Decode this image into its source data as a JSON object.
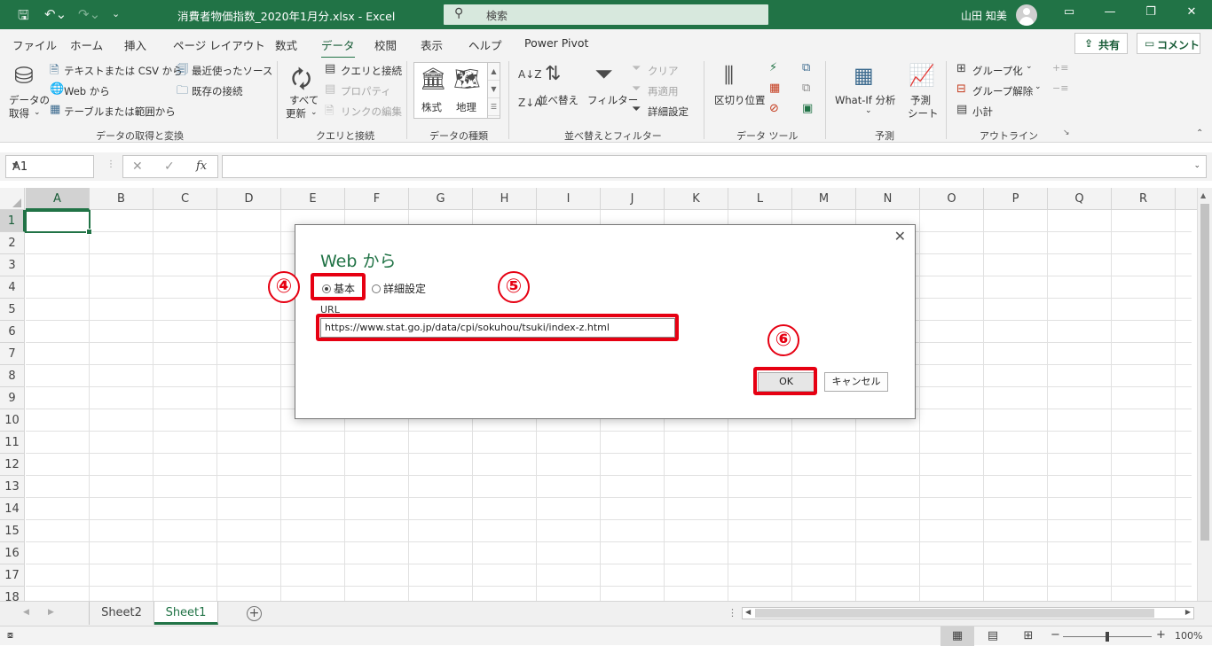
{
  "titlebar": {
    "filename": "消費者物価指数_2020年1月分.xlsx  -  Excel",
    "search_label": "検索",
    "user": "山田 知美"
  },
  "tabs": [
    "ファイル",
    "ホーム",
    "挿入",
    "ページ レイアウト",
    "数式",
    "データ",
    "校閲",
    "表示",
    "ヘルプ",
    "Power Pivot"
  ],
  "active_tab": "データ",
  "share_label": "共有",
  "comment_label": "コメント",
  "ribbon": {
    "get_data_1": "データの",
    "get_data_2": "取得",
    "from_text_csv": "テキストまたは CSV から",
    "from_web": "Web から",
    "from_table": "テーブルまたは範囲から",
    "recent_sources": "最近使ったソース",
    "existing_connections": "既存の接続",
    "group_get_transform": "データの取得と変換",
    "refresh_all_1": "すべて",
    "refresh_all_2": "更新",
    "queries_connections": "クエリと接続",
    "properties": "プロパティ",
    "edit_links": "リンクの編集",
    "group_queries": "クエリと接続",
    "stocks": "株式",
    "geography": "地理",
    "group_data_types": "データの種類",
    "sort": "並べ替え",
    "filter": "フィルター",
    "clear": "クリア",
    "reapply": "再適用",
    "advanced": "詳細設定",
    "group_sort_filter": "並べ替えとフィルター",
    "text_to_columns": "区切り位置",
    "group_data_tools": "データ ツール",
    "whatif": "What-If 分析",
    "forecast_sheet_1": "予測",
    "forecast_sheet_2": "シート",
    "group_forecast": "予測",
    "group": "グループ化",
    "ungroup": "グループ解除",
    "subtotal": "小計",
    "group_outline": "アウトライン"
  },
  "formula_bar": {
    "name_box": "A1",
    "cancel": "✕",
    "enter": "✓",
    "fx": "fx",
    "formula": ""
  },
  "columns": [
    "A",
    "B",
    "C",
    "D",
    "E",
    "F",
    "G",
    "H",
    "I",
    "J",
    "K",
    "L",
    "M",
    "N",
    "O",
    "P",
    "Q",
    "R"
  ],
  "rows": [
    "1",
    "2",
    "3",
    "4",
    "5",
    "6",
    "7",
    "8",
    "9",
    "10",
    "11",
    "12",
    "13",
    "14",
    "15",
    "16",
    "17",
    "18"
  ],
  "active_cell": "A1",
  "sheets": [
    "Sheet2",
    "Sheet1"
  ],
  "active_sheet": "Sheet1",
  "zoom": "100%",
  "dialog": {
    "title": "Web から",
    "radio_basic": "基本",
    "radio_advanced": "詳細設定",
    "selected_mode": "基本",
    "url_label": "URL",
    "url_value": "https://www.stat.go.jp/data/cpi/sokuhou/tsuki/index-z.html",
    "ok_label": "OK",
    "cancel_label": "キャンセル"
  },
  "annotations": {
    "step4": "④",
    "step5": "⑤",
    "step6": "⑥",
    "color": "#e60012"
  },
  "colors": {
    "excel_green": "#217346",
    "highlight_red": "#e60012"
  }
}
